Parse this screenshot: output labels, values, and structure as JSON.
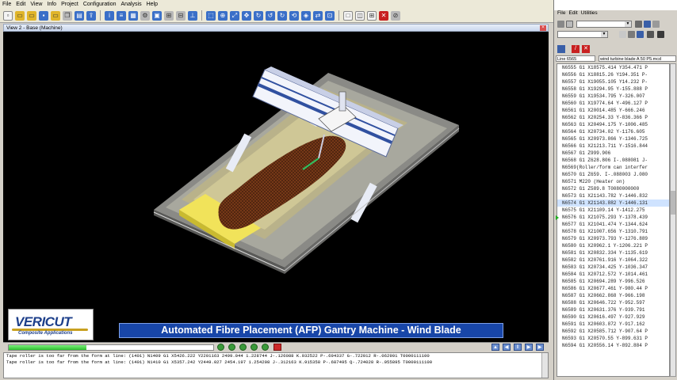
{
  "menu": [
    "File",
    "Edit",
    "View",
    "Info",
    "Project",
    "Configuration",
    "Analysis",
    "Help"
  ],
  "view": {
    "title": "View 2 - Base (Machine)"
  },
  "logo": {
    "name": "VERICUT",
    "tagline": "Composite Applications"
  },
  "banner": {
    "text": "Automated Fibre Placement (AFP)  Gantry Machine - Wind Blade"
  },
  "playback": {
    "progress_percent": 38
  },
  "messages": [
    "Tape roller is too far from the form at line: (1401) N1409 G1 X5426.222 Y2201163 2499.044 1.228744 J-.126088 K.932522 P-.694337 G-.722012 R-.062901 T0000111100",
    "Tape roller is too far from the form at line: (1401) N1410 G1 X5357.242 Y2449.027 2454.197 1.254208 J-.312163 K.915358 P-.687495 Q-.724028 R-.055895 T0000111100"
  ],
  "right_panel": {
    "menu": [
      "File",
      "Edit",
      "Utilities"
    ],
    "line_label": "Line 6565",
    "file_name": "wind turbine blade A 50 P5.mcd"
  },
  "nc_lines": [
    "N6555 G1 X18575.414 Y354.471 P",
    "N6556 G1 X18815.26 Y194.351 P-",
    "N6557 G1 X19055.105 Y14.232 P-",
    "N6558 G1 X19294.95 Y-155.888 P",
    "N6559 G1 X19534.795 Y-326.007",
    "N6560 G1 X19774.64 Y-496.127 P",
    "N6561 G1 X20014.485 Y-666.246",
    "N6562 G1 X20254.33 Y-836.366 P",
    "N6563 G1 X20494.175 Y-1006.485",
    "N6564 G1 X20734.02 Y-1176.605",
    "N6565 G1 X20973.866 Y-1346.725",
    "N6566 G1 X21213.711 Y-1516.844",
    "N6567 G1 Z999.906",
    "N6568 G1 Z628.806 I-.088081 J-",
    "N6569(Roller/form can interfer",
    "N6570 G1 Z659. I-.088003 J.080",
    "N6571 M220 (Heater on)",
    "N6572 G1 Z589.8 T0080000000",
    "N6573 G1 X21143.782 Y-1446.832",
    "N6574 G1 X21143.882 Y-1446.131",
    "N6575 G1 X21109.14 Y-1412.275",
    "N6576 G1 X21075.293 Y-1378.439",
    "N6577 G1 X21041.474 Y-1344.624",
    "N6578 G1 X21007.656 Y-1310.791",
    "N6579 G1 X20973.793 Y-1276.889",
    "N6580 G1 X20962.1 Y-1206.221 P",
    "N6581 G1 X20832.334 Y-1135.619",
    "N6582 G1 X20761.916 Y-1064.322",
    "N6583 G1 X20734.425 Y-1036.347",
    "N6584 G1 X20712.572 Y-1014.461",
    "N6585 G1 X20694.289 Y-996.526",
    "N6586 G1 X20677.461 Y-980.44 P",
    "N6587 G1 X20662.868 Y-966.198",
    "N6588 G1 X20646.722 Y-952.597",
    "N6589 G1 X20631.376 Y-939.791",
    "N6590 G1 X20616.497 Y-927.929",
    "N6591 G1 X20603.872 Y-917.162",
    "N6592 G1 X20585.712 Y-907.64 P",
    "N6593 G1 X20570.55 Y-899.631 P",
    "N6594 G1 X20556.14 Y-892.884 P"
  ],
  "current_row_index": 19,
  "colors": {
    "banner": "#1846a8",
    "progress": "#2fc02f",
    "viewport": "#000000"
  }
}
